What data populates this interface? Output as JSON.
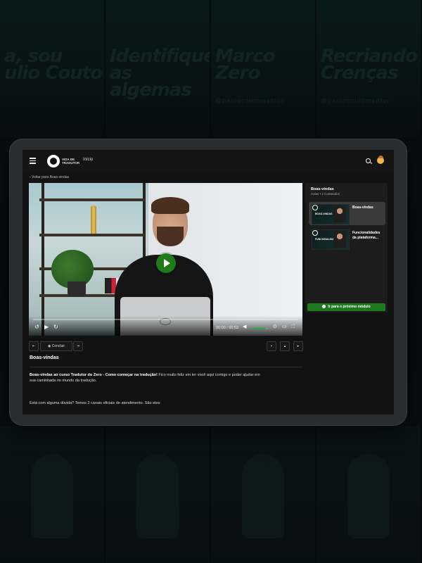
{
  "background": {
    "posters": [
      {
        "kicker": "",
        "title_line1": "a, sou",
        "title_line2": "ulio Couto",
        "handle": ""
      },
      {
        "kicker": "",
        "title_line1": "Identifique",
        "title_line2": "as algemas",
        "handle": ""
      },
      {
        "kicker": "",
        "title_line1": "Marco",
        "title_line2": "Zero",
        "handle": "@paulocoutomentor"
      },
      {
        "kicker": "",
        "title_line1": "Recriando",
        "title_line2": "Crenças",
        "handle": "@paulocoutomentor"
      }
    ]
  },
  "header": {
    "logo_text_line1": "VIDA DE",
    "logo_text_line2": "TRADUTOR",
    "nav_home": "Início"
  },
  "breadcrumb": "‹ Voltar para Boas-vindas",
  "player": {
    "current_time": "00:00",
    "duration": "00:53",
    "progress": 0.0,
    "volume": 0.8,
    "time_display": "00:00 / 00:53"
  },
  "sidebar": {
    "module_title": "Boas-vindas",
    "module_subtitle": "Aulas • 2 Conteúdos",
    "lessons": [
      {
        "label": "Boas-vindas",
        "thumb_text": "BOAS-VINDAS",
        "active": true
      },
      {
        "label": "Funcionalidades da plataforma...",
        "thumb_text": "FUNCIONALIDADES",
        "active": false
      }
    ],
    "next_module_label": "Ir para o próximo módulo"
  },
  "actions": {
    "complete_label": "Concluir"
  },
  "lesson": {
    "title": "Boas-vindas",
    "description_bold": "Boas-vindas ao curso Tradutor do Zero - Como começar na tradução!",
    "description_rest": " Fico muito feliz em ter você aqui comigo e poder ajudar em sua caminhada no mundo da tradução.",
    "support_text": "Está com alguma dúvida? Temos 2 canais oficiais de atendimento. São eles:"
  },
  "colors": {
    "accent": "#1e7a1c",
    "background": "#121212",
    "panel": "#1c1c1c"
  }
}
